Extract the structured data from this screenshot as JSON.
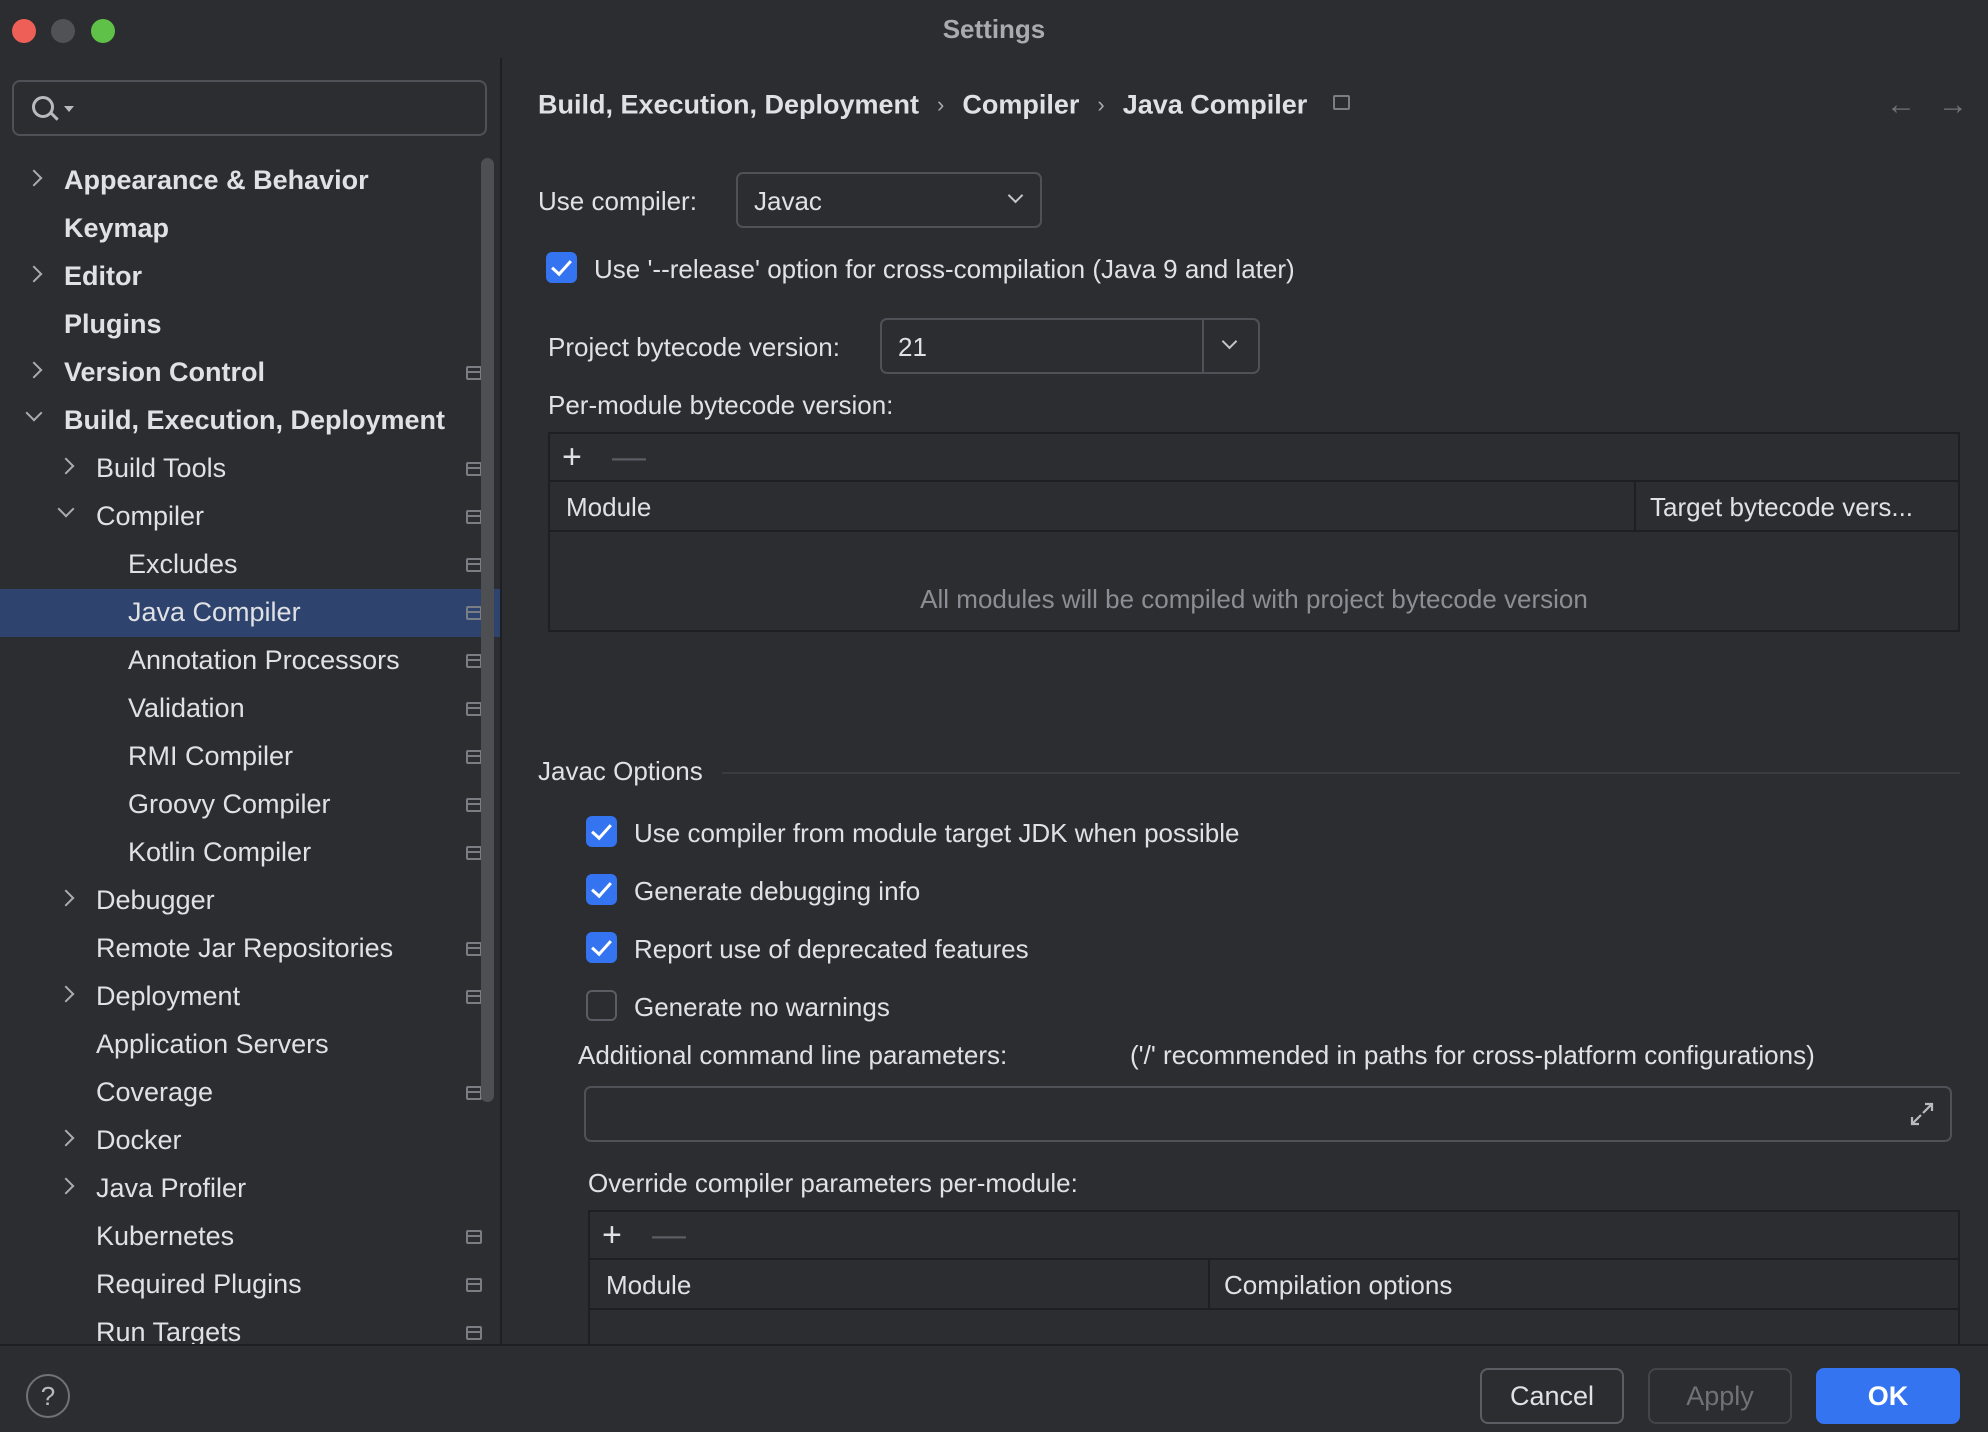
{
  "window": {
    "title": "Settings"
  },
  "search": {
    "value": "",
    "placeholder": ""
  },
  "sidebar": {
    "items": [
      {
        "label": "Appearance & Behavior",
        "level": 0,
        "bold": true,
        "expander": "right",
        "project": false,
        "selected": false
      },
      {
        "label": "Keymap",
        "level": 0,
        "bold": true,
        "expander": "none",
        "project": false,
        "selected": false
      },
      {
        "label": "Editor",
        "level": 0,
        "bold": true,
        "expander": "right",
        "project": false,
        "selected": false
      },
      {
        "label": "Plugins",
        "level": 0,
        "bold": true,
        "expander": "none",
        "project": false,
        "selected": false
      },
      {
        "label": "Version Control",
        "level": 0,
        "bold": true,
        "expander": "right",
        "project": true,
        "selected": false
      },
      {
        "label": "Build, Execution, Deployment",
        "level": 0,
        "bold": true,
        "expander": "down",
        "project": false,
        "selected": false
      },
      {
        "label": "Build Tools",
        "level": 1,
        "bold": false,
        "expander": "right",
        "project": true,
        "selected": false
      },
      {
        "label": "Compiler",
        "level": 1,
        "bold": false,
        "expander": "down",
        "project": true,
        "selected": false
      },
      {
        "label": "Excludes",
        "level": 2,
        "bold": false,
        "expander": "none",
        "project": true,
        "selected": false
      },
      {
        "label": "Java Compiler",
        "level": 2,
        "bold": false,
        "expander": "none",
        "project": true,
        "selected": true
      },
      {
        "label": "Annotation Processors",
        "level": 2,
        "bold": false,
        "expander": "none",
        "project": true,
        "selected": false
      },
      {
        "label": "Validation",
        "level": 2,
        "bold": false,
        "expander": "none",
        "project": true,
        "selected": false
      },
      {
        "label": "RMI Compiler",
        "level": 2,
        "bold": false,
        "expander": "none",
        "project": true,
        "selected": false
      },
      {
        "label": "Groovy Compiler",
        "level": 2,
        "bold": false,
        "expander": "none",
        "project": true,
        "selected": false
      },
      {
        "label": "Kotlin Compiler",
        "level": 2,
        "bold": false,
        "expander": "none",
        "project": true,
        "selected": false
      },
      {
        "label": "Debugger",
        "level": 1,
        "bold": false,
        "expander": "right",
        "project": false,
        "selected": false
      },
      {
        "label": "Remote Jar Repositories",
        "level": 1,
        "bold": false,
        "expander": "none",
        "project": true,
        "selected": false
      },
      {
        "label": "Deployment",
        "level": 1,
        "bold": false,
        "expander": "right",
        "project": true,
        "selected": false
      },
      {
        "label": "Application Servers",
        "level": 1,
        "bold": false,
        "expander": "none",
        "project": false,
        "selected": false
      },
      {
        "label": "Coverage",
        "level": 1,
        "bold": false,
        "expander": "none",
        "project": true,
        "selected": false
      },
      {
        "label": "Docker",
        "level": 1,
        "bold": false,
        "expander": "right",
        "project": false,
        "selected": false
      },
      {
        "label": "Java Profiler",
        "level": 1,
        "bold": false,
        "expander": "right",
        "project": false,
        "selected": false
      },
      {
        "label": "Kubernetes",
        "level": 1,
        "bold": false,
        "expander": "none",
        "project": true,
        "selected": false
      },
      {
        "label": "Required Plugins",
        "level": 1,
        "bold": false,
        "expander": "none",
        "project": true,
        "selected": false
      },
      {
        "label": "Run Targets",
        "level": 1,
        "bold": false,
        "expander": "none",
        "project": true,
        "selected": false
      }
    ]
  },
  "breadcrumb": {
    "items": [
      "Build, Execution, Deployment",
      "Compiler",
      "Java Compiler"
    ],
    "separator": "›",
    "back_icon": "←",
    "forward_icon": "→"
  },
  "main": {
    "use_compiler_label": "Use compiler:",
    "use_compiler_value": "Javac",
    "release_option": {
      "label": "Use '--release' option for cross-compilation (Java 9 and later)",
      "checked": true
    },
    "project_bytecode_label": "Project bytecode version:",
    "project_bytecode_value": "21",
    "per_module_label": "Per-module bytecode version:",
    "per_module_table": {
      "add": "+",
      "remove": "—",
      "columns": [
        "Module",
        "Target bytecode vers..."
      ],
      "empty_text": "All modules will be compiled with project bytecode version"
    },
    "javac_section": "Javac Options",
    "javac_options": [
      {
        "label": "Use compiler from module target JDK when possible",
        "checked": true
      },
      {
        "label": "Generate debugging info",
        "checked": true
      },
      {
        "label": "Report use of deprecated features",
        "checked": true
      },
      {
        "label": "Generate no warnings",
        "checked": false
      }
    ],
    "additional_params_label": "Additional command line parameters:",
    "additional_params_hint": "('/' recommended in paths for cross-platform configurations)",
    "additional_params_value": "",
    "override_label": "Override compiler parameters per-module:",
    "override_table": {
      "add": "+",
      "remove": "—",
      "columns": [
        "Module",
        "Compilation options"
      ]
    }
  },
  "footer": {
    "help": "?",
    "cancel": "Cancel",
    "apply": "Apply",
    "ok": "OK"
  },
  "colors": {
    "accent": "#3574f0",
    "selection": "#2e436e",
    "background": "#2b2d30"
  }
}
